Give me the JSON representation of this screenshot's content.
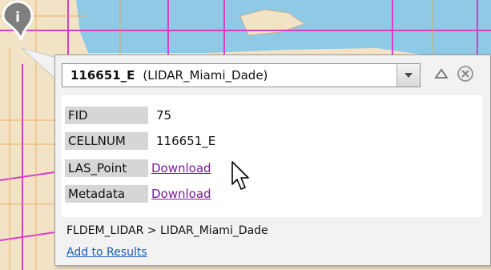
{
  "popup": {
    "feature_id": "116651_E",
    "layer_label": "(LIDAR_Miami_Dade)",
    "attributes": [
      {
        "key": "FID",
        "value": "75"
      },
      {
        "key": "CELLNUM",
        "value": "116651_E"
      },
      {
        "key": "LAS_Point",
        "link": "Download"
      },
      {
        "key": "Metadata",
        "link": "Download"
      }
    ],
    "layer_path": "FLDEM_LIDAR > LIDAR_Miami_Dade",
    "add_to_results": "Add to Results"
  },
  "icons": {
    "info": "info-icon",
    "dropdown": "chevron-down-icon",
    "collapse": "triangle-up-icon",
    "close": "close-circle-icon",
    "cursor": "pointer-cursor-icon"
  },
  "colors": {
    "map_land": "#f3e3c6",
    "map_water": "#8ec9e6",
    "road_magenta": "#d63fc6",
    "road_orange": "#e8a34a",
    "link_visited": "#7a1a9a",
    "link": "#1a5fb4"
  }
}
